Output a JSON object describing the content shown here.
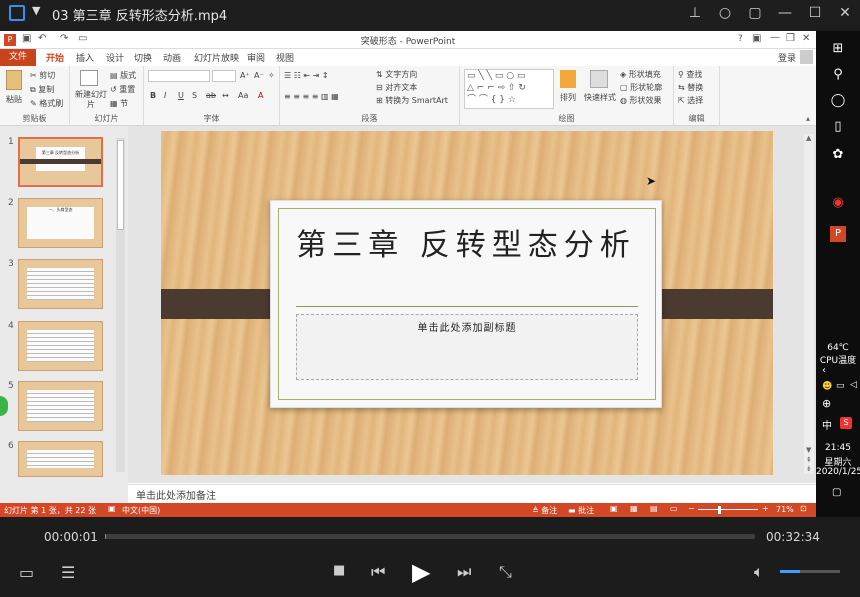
{
  "player": {
    "window_title": "03 第三章 反转形态分析.mp4",
    "current_time": "00:00:01",
    "total_time": "00:32:34",
    "progress_fraction": 0.0005,
    "volume_fraction": 0.33
  },
  "ppt": {
    "window_title": "突破形态 - PowerPoint",
    "help": "?",
    "login": "登录",
    "tabs": [
      "文件",
      "开始",
      "插入",
      "设计",
      "切换",
      "动画",
      "幻灯片放映",
      "审阅",
      "视图"
    ],
    "active_tab": "开始",
    "ribbon": {
      "clipboard": {
        "label": "剪贴板",
        "paste": "粘贴",
        "cut": "剪切",
        "copy": "复制",
        "format_painter": "格式刷"
      },
      "slides": {
        "label": "幻灯片",
        "new_slide": "新建幻灯片",
        "layout": "版式",
        "reset": "重置",
        "section": "节"
      },
      "font": {
        "label": "字体",
        "bold": "B",
        "italic": "I",
        "underline": "U",
        "shadow": "S"
      },
      "paragraph": {
        "label": "段落",
        "text_direction": "文字方向",
        "align_text": "对齐文本",
        "smartart": "转换为 SmartArt"
      },
      "drawing": {
        "label": "绘图",
        "arrange": "排列",
        "quick_styles": "快速样式",
        "shape_fill": "形状填充",
        "shape_outline": "形状轮廓",
        "shape_effects": "形状效果"
      },
      "editing": {
        "label": "编辑",
        "find": "查找",
        "replace": "替换",
        "select": "选择"
      }
    },
    "thumbnail_numbers": [
      "1",
      "2",
      "3",
      "4",
      "5",
      "6"
    ],
    "thumbnail_texts": [
      "第三章  反转型态分析",
      "一、头肩型态"
    ],
    "slide": {
      "title": "第三章 反转型态分析",
      "subtitle": "单击此处添加副标题"
    },
    "notes_placeholder": "单击此处添加备注",
    "status": {
      "slide_info": "幻灯片 第 1 张，共 22 张",
      "language": "中文(中国)",
      "notes": "备注",
      "comments": "批注",
      "zoom": "71%"
    }
  },
  "taskbar": {
    "temperature": "64℃",
    "cpu_label": "CPU温度",
    "ime": "中",
    "clock_time": "21:45",
    "clock_day": "星期六",
    "clock_date": "2020/1/25"
  },
  "colors": {
    "ppt_accent": "#d24726",
    "player_bg": "#1c1c1c",
    "volume_accent": "#3da0ff"
  }
}
